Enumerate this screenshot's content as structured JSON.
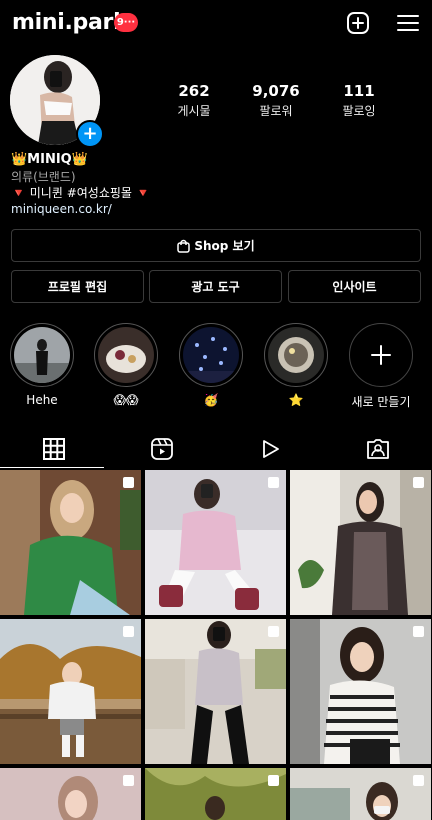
{
  "header": {
    "username": "mini.park",
    "notification_badge": "9···",
    "new_post_icon": "plus-square-icon",
    "menu_icon": "hamburger-menu-icon"
  },
  "profile": {
    "avatar_icon": "profile-avatar",
    "stats": [
      {
        "value": "262",
        "label": "게시물"
      },
      {
        "value": "9,076",
        "label": "팔로워"
      },
      {
        "value": "111",
        "label": "팔로잉"
      }
    ],
    "bio": {
      "name": "👑MINIQ👑",
      "category": "의류(브랜드)",
      "line": "🔻 미니퀸 #여성쇼핑몰 🔻",
      "link": "miniqueen.co.kr/"
    }
  },
  "actions": {
    "shop": "Shop 보기",
    "edit_profile": "프로필 편집",
    "ad_tools": "광고 도구",
    "insights": "인사이트"
  },
  "highlights": [
    {
      "label": "Hehe"
    },
    {
      "label": "😱😱"
    },
    {
      "label": "🥳"
    },
    {
      "label": "⭐"
    },
    {
      "label": "새로 만들기"
    }
  ],
  "tabs": [
    "grid-icon",
    "reels-icon",
    "video-play-icon",
    "tagged-icon"
  ],
  "colors": {
    "background": "#000000",
    "accent": "#0095f6",
    "badge": "#ff3040"
  }
}
